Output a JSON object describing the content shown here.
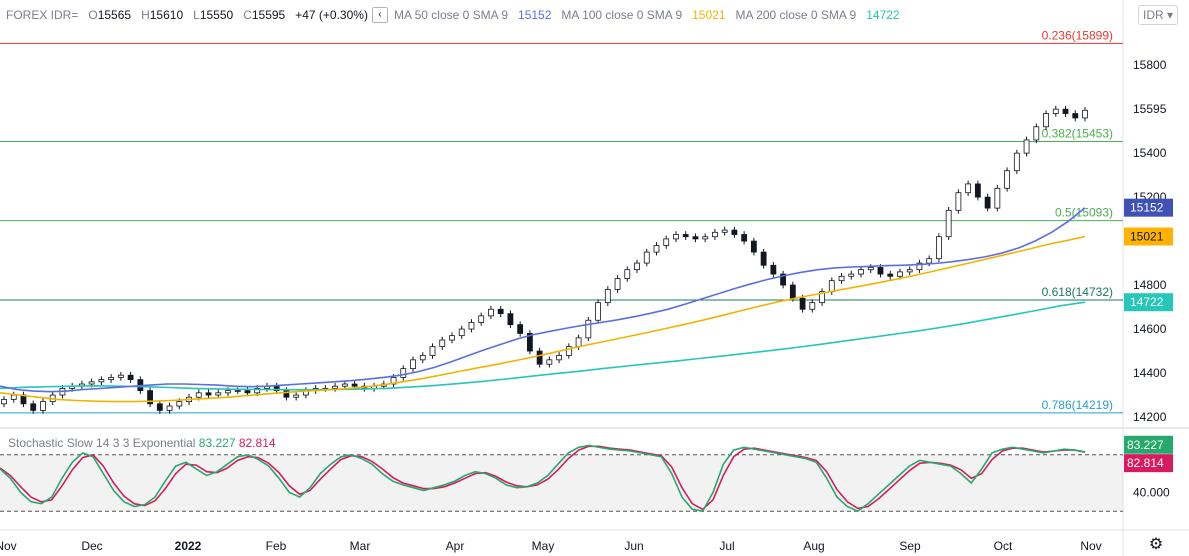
{
  "header": {
    "symbol": "FOREX IDR=",
    "open_label": "O",
    "open": "15565",
    "high_label": "H",
    "high": "15610",
    "low_label": "L",
    "low": "15550",
    "close_label": "C",
    "close": "15595",
    "change": "+47 (+0.30%)",
    "collapse_icon": "chevron-left-icon",
    "ma50": {
      "label": "MA 50 close 0 SMA 9",
      "value": "15152",
      "color": "#5b6ee1"
    },
    "ma100": {
      "label": "MA 100 close 0 SMA 9",
      "value": "15021",
      "color": "#f0b400"
    },
    "ma200": {
      "label": "MA 200 close 0 SMA 9",
      "value": "14722",
      "color": "#26c6b8"
    },
    "currency_select": "IDR"
  },
  "stochastic": {
    "label": "Stochastic Slow 14 3 3 Exponential",
    "k_value": "83.227",
    "k_color": "#26a96a",
    "d_value": "82.814",
    "d_color": "#d81b60",
    "axis_label": "40.000",
    "settings_icon": "gear-icon"
  },
  "chart_data": {
    "type": "candlestick",
    "price_axis_ticks": [
      15800,
      15600,
      15400,
      15200,
      15000,
      14800,
      14600,
      14400,
      14200
    ],
    "price_axis_labels": [
      "15800",
      "15595",
      "15400",
      "15200",
      "15021",
      "14800",
      "14600",
      "14400",
      "14200"
    ],
    "time_axis_labels": [
      "Nov",
      "Dec",
      "2022",
      "Feb",
      "Mar",
      "Apr",
      "May",
      "Jun",
      "Jul",
      "Aug",
      "Sep",
      "Oct",
      "Nov"
    ],
    "ylim": [
      14150,
      15960
    ],
    "last_price": 15595,
    "fib_levels": [
      {
        "label": "0.236(15899)",
        "value": 15899,
        "color": "#e53935"
      },
      {
        "label": "0.382(15453)",
        "value": 15453,
        "color": "#4caf50"
      },
      {
        "label": "0.5(15093)",
        "value": 15093,
        "color": "#4caf50"
      },
      {
        "label": "0.618(14732)",
        "value": 14732,
        "color": "#1b7a5a"
      },
      {
        "label": "0.786(14219)",
        "value": 14219,
        "color": "#26a0c8"
      }
    ],
    "price_markers": [
      {
        "label": "15152",
        "value": 15152,
        "bg": "#3f51b5"
      },
      {
        "label": "15021",
        "value": 15021,
        "bg": "#ffb300"
      },
      {
        "label": "14722",
        "value": 14722,
        "bg": "#26c6b8"
      }
    ],
    "closes": [
      14280,
      14300,
      14260,
      14230,
      14270,
      14300,
      14330,
      14340,
      14350,
      14360,
      14370,
      14380,
      14390,
      14370,
      14320,
      14260,
      14230,
      14250,
      14270,
      14290,
      14310,
      14300,
      14310,
      14320,
      14320,
      14310,
      14330,
      14340,
      14320,
      14290,
      14300,
      14320,
      14330,
      14330,
      14340,
      14350,
      14340,
      14330,
      14340,
      14350,
      14380,
      14420,
      14460,
      14480,
      14520,
      14550,
      14570,
      14600,
      14630,
      14660,
      14690,
      14670,
      14620,
      14580,
      14500,
      14440,
      14460,
      14480,
      14520,
      14560,
      14640,
      14720,
      14780,
      14830,
      14870,
      14900,
      14950,
      14980,
      15010,
      15030,
      15020,
      15010,
      15020,
      15040,
      15050,
      15030,
      15000,
      14950,
      14890,
      14850,
      14800,
      14740,
      14690,
      14720,
      14770,
      14820,
      14840,
      14850,
      14870,
      14880,
      14850,
      14840,
      14860,
      14870,
      14900,
      14920,
      15020,
      15140,
      15220,
      15260,
      15200,
      15150,
      15240,
      15320,
      15400,
      15460,
      15520,
      15580,
      15600,
      15580,
      15560,
      15595
    ],
    "ma50": [
      14340,
      14325,
      14318,
      14315,
      14318,
      14325,
      14330,
      14335,
      14340,
      14345,
      14350,
      14350,
      14348,
      14345,
      14340,
      14338,
      14340,
      14345,
      14350,
      14355,
      14360,
      14365,
      14372,
      14380,
      14390,
      14405,
      14425,
      14450,
      14478,
      14505,
      14530,
      14555,
      14575,
      14590,
      14605,
      14618,
      14630,
      14642,
      14656,
      14672,
      14690,
      14712,
      14736,
      14760,
      14784,
      14806,
      14826,
      14843,
      14858,
      14870,
      14878,
      14882,
      14885,
      14888,
      14890,
      14893,
      14898,
      14906,
      14916,
      14928,
      14945,
      14968,
      15000,
      15040,
      15090,
      15152
    ],
    "ma100": [
      14310,
      14300,
      14290,
      14280,
      14275,
      14272,
      14270,
      14270,
      14272,
      14275,
      14280,
      14285,
      14290,
      14298,
      14305,
      14312,
      14318,
      14322,
      14328,
      14335,
      14345,
      14358,
      14372,
      14388,
      14405,
      14422,
      14438,
      14455,
      14473,
      14492,
      14512,
      14530,
      14548,
      14566,
      14584,
      14603,
      14622,
      14642,
      14663,
      14685,
      14706,
      14726,
      14744,
      14760,
      14776,
      14792,
      14808,
      14825,
      14843,
      14862,
      14882,
      14902,
      14922,
      14942,
      14962,
      14984,
      15002,
      15021
    ],
    "ma200": [
      14330,
      14335,
      14338,
      14340,
      14342,
      14340,
      14338,
      14334,
      14330,
      14328,
      14326,
      14325,
      14324,
      14324,
      14325,
      14327,
      14330,
      14336,
      14343,
      14352,
      14362,
      14373,
      14385,
      14397,
      14408,
      14420,
      14432,
      14443,
      14454,
      14466,
      14478,
      14490,
      14503,
      14516,
      14530,
      14545,
      14560,
      14575,
      14590,
      14607,
      14625,
      14645,
      14665,
      14685,
      14706,
      14722
    ],
    "stoch_k": [
      65,
      55,
      40,
      30,
      28,
      35,
      55,
      72,
      82,
      78,
      60,
      42,
      30,
      25,
      27,
      35,
      52,
      68,
      72,
      65,
      58,
      62,
      70,
      78,
      80,
      75,
      68,
      55,
      40,
      35,
      45,
      60,
      70,
      78,
      80,
      76,
      70,
      60,
      52,
      48,
      45,
      42,
      45,
      48,
      52,
      58,
      62,
      60,
      55,
      48,
      45,
      46,
      50,
      58,
      70,
      82,
      88,
      90,
      88,
      86,
      85,
      84,
      82,
      80,
      78,
      60,
      35,
      22,
      20,
      40,
      70,
      85,
      88,
      86,
      84,
      82,
      80,
      78,
      76,
      72,
      55,
      35,
      25,
      20,
      28,
      38,
      48,
      58,
      68,
      74,
      72,
      70,
      68,
      60,
      50,
      65,
      82,
      86,
      88,
      86,
      84,
      82,
      84,
      86,
      85,
      83.2
    ],
    "stoch_d": [
      66,
      58,
      46,
      35,
      30,
      32,
      47,
      64,
      77,
      80,
      68,
      50,
      36,
      28,
      26,
      31,
      44,
      60,
      70,
      69,
      62,
      61,
      66,
      74,
      78,
      77,
      71,
      61,
      47,
      38,
      42,
      54,
      65,
      75,
      79,
      78,
      73,
      65,
      56,
      50,
      47,
      44,
      44,
      46,
      50,
      55,
      60,
      61,
      57,
      51,
      47,
      46,
      48,
      54,
      64,
      76,
      85,
      89,
      89,
      87,
      86,
      85,
      83,
      81,
      79,
      67,
      45,
      28,
      22,
      32,
      58,
      78,
      86,
      87,
      85,
      83,
      81,
      79,
      77,
      74,
      62,
      43,
      30,
      23,
      25,
      33,
      43,
      53,
      63,
      71,
      72,
      71,
      69,
      64,
      55,
      60,
      75,
      84,
      87,
      87,
      85,
      83,
      84,
      85,
      85,
      82.8
    ]
  }
}
